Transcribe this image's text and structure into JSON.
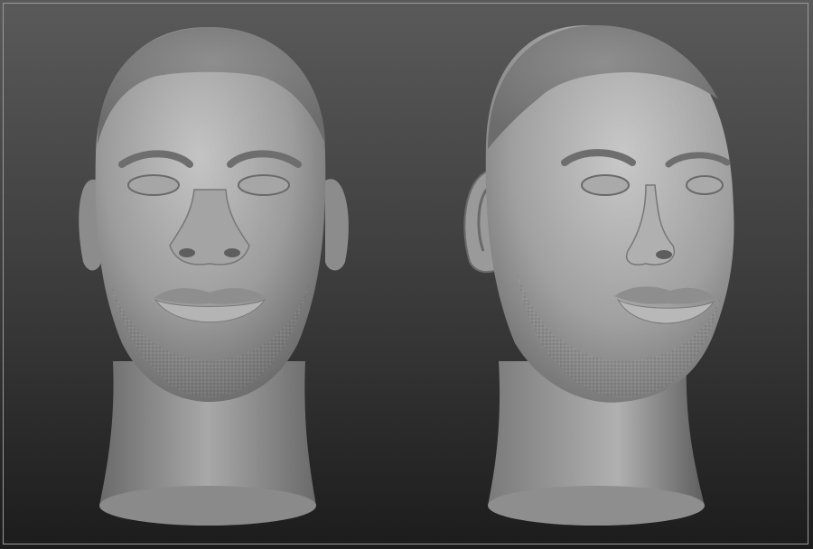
{
  "scene": {
    "background_top_color": "#5a5a5a",
    "background_bottom_color": "#1c1c1c",
    "frame_color": "#9a9a9a",
    "material_color": "#9c9c9c",
    "subject": "sculpted-head",
    "views": [
      {
        "view": "front"
      },
      {
        "view": "three-quarter-right"
      }
    ]
  }
}
